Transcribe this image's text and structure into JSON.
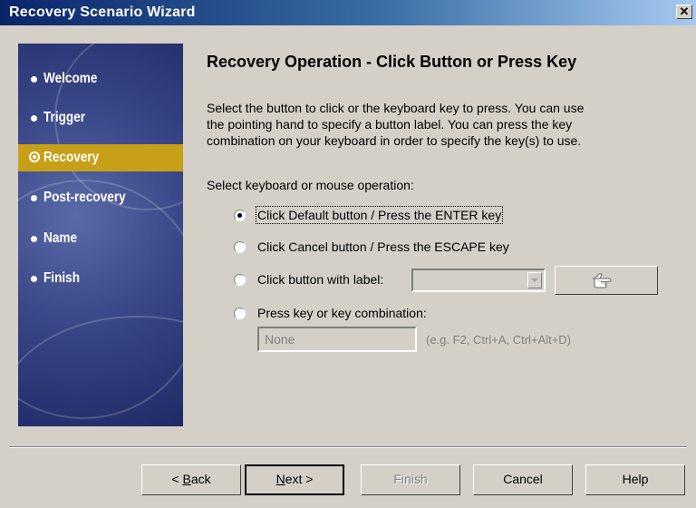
{
  "window": {
    "title": "Recovery Scenario Wizard",
    "close_glyph": "✕"
  },
  "nav": {
    "items": [
      {
        "label": "Welcome",
        "active": false
      },
      {
        "label": "Trigger",
        "active": false
      },
      {
        "label": "Recovery",
        "active": true
      },
      {
        "label": "Post-recovery",
        "active": false
      },
      {
        "label": "Name",
        "active": false
      },
      {
        "label": "Finish",
        "active": false
      }
    ],
    "active_color": "#c8a018"
  },
  "main": {
    "heading": "Recovery Operation - Click Button or Press Key",
    "description": [
      "Select the button to click or the keyboard key to press. You can use",
      "the pointing hand to specify a button label. You can press the key",
      "combination on your keyboard in order to specify the key(s) to use."
    ],
    "select_label": "Select keyboard or mouse operation:",
    "options": [
      {
        "label": "Click Default button / Press the ENTER key",
        "checked": true
      },
      {
        "label": "Click Cancel button / Press the ESCAPE key",
        "checked": false
      },
      {
        "label": "Click button with label:",
        "checked": false
      },
      {
        "label": "Press key or key combination:",
        "checked": false
      }
    ],
    "button_label_combo": {
      "value": ""
    },
    "pointing_hand_icon": "pointing-hand-icon",
    "key_field": {
      "value": "None"
    },
    "key_example": "(e.g. F2, Ctrl+A, Ctrl+Alt+D)"
  },
  "footer": {
    "back": {
      "accel": "B",
      "rest": "ack",
      "prefix": "< "
    },
    "next": {
      "accel": "N",
      "rest": "ext >"
    },
    "finish": "Finish",
    "cancel": "Cancel",
    "help": "Help"
  }
}
